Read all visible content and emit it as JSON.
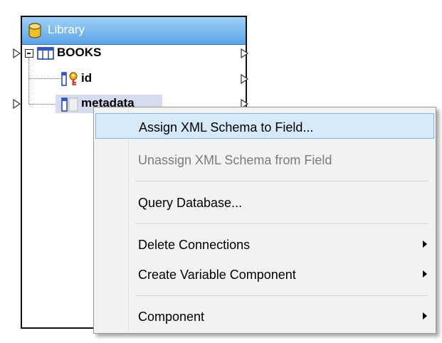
{
  "component": {
    "title": "Library",
    "icon": "database-icon",
    "header_color": "#5aa5e8"
  },
  "tree": {
    "root": {
      "label": "BOOKS",
      "icon": "table-icon"
    },
    "fields": [
      {
        "label": "id",
        "icon": "key-field-icon"
      },
      {
        "label": "metadata",
        "icon": "field-icon"
      }
    ]
  },
  "context_menu": {
    "items": [
      {
        "label": "Assign XML Schema to Field...",
        "state": "selected",
        "submenu": false
      },
      {
        "label": "Unassign XML Schema from Field",
        "state": "disabled",
        "submenu": false
      },
      {
        "label": "Query Database...",
        "state": "normal",
        "submenu": false
      },
      {
        "label": "Delete Connections",
        "state": "normal",
        "submenu": true
      },
      {
        "label": "Create Variable Component",
        "state": "normal",
        "submenu": true
      },
      {
        "label": "Component",
        "state": "normal",
        "submenu": true
      }
    ],
    "highlight_color": "#d6e9f9"
  }
}
